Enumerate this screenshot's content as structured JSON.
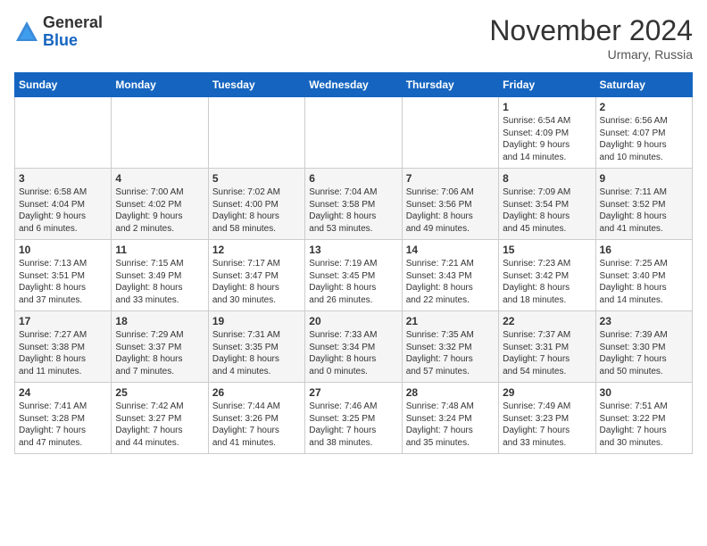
{
  "logo": {
    "general": "General",
    "blue": "Blue"
  },
  "header": {
    "month": "November 2024",
    "location": "Urmary, Russia"
  },
  "weekdays": [
    "Sunday",
    "Monday",
    "Tuesday",
    "Wednesday",
    "Thursday",
    "Friday",
    "Saturday"
  ],
  "weeks": [
    [
      {
        "day": "",
        "info": ""
      },
      {
        "day": "",
        "info": ""
      },
      {
        "day": "",
        "info": ""
      },
      {
        "day": "",
        "info": ""
      },
      {
        "day": "",
        "info": ""
      },
      {
        "day": "1",
        "info": "Sunrise: 6:54 AM\nSunset: 4:09 PM\nDaylight: 9 hours\nand 14 minutes."
      },
      {
        "day": "2",
        "info": "Sunrise: 6:56 AM\nSunset: 4:07 PM\nDaylight: 9 hours\nand 10 minutes."
      }
    ],
    [
      {
        "day": "3",
        "info": "Sunrise: 6:58 AM\nSunset: 4:04 PM\nDaylight: 9 hours\nand 6 minutes."
      },
      {
        "day": "4",
        "info": "Sunrise: 7:00 AM\nSunset: 4:02 PM\nDaylight: 9 hours\nand 2 minutes."
      },
      {
        "day": "5",
        "info": "Sunrise: 7:02 AM\nSunset: 4:00 PM\nDaylight: 8 hours\nand 58 minutes."
      },
      {
        "day": "6",
        "info": "Sunrise: 7:04 AM\nSunset: 3:58 PM\nDaylight: 8 hours\nand 53 minutes."
      },
      {
        "day": "7",
        "info": "Sunrise: 7:06 AM\nSunset: 3:56 PM\nDaylight: 8 hours\nand 49 minutes."
      },
      {
        "day": "8",
        "info": "Sunrise: 7:09 AM\nSunset: 3:54 PM\nDaylight: 8 hours\nand 45 minutes."
      },
      {
        "day": "9",
        "info": "Sunrise: 7:11 AM\nSunset: 3:52 PM\nDaylight: 8 hours\nand 41 minutes."
      }
    ],
    [
      {
        "day": "10",
        "info": "Sunrise: 7:13 AM\nSunset: 3:51 PM\nDaylight: 8 hours\nand 37 minutes."
      },
      {
        "day": "11",
        "info": "Sunrise: 7:15 AM\nSunset: 3:49 PM\nDaylight: 8 hours\nand 33 minutes."
      },
      {
        "day": "12",
        "info": "Sunrise: 7:17 AM\nSunset: 3:47 PM\nDaylight: 8 hours\nand 30 minutes."
      },
      {
        "day": "13",
        "info": "Sunrise: 7:19 AM\nSunset: 3:45 PM\nDaylight: 8 hours\nand 26 minutes."
      },
      {
        "day": "14",
        "info": "Sunrise: 7:21 AM\nSunset: 3:43 PM\nDaylight: 8 hours\nand 22 minutes."
      },
      {
        "day": "15",
        "info": "Sunrise: 7:23 AM\nSunset: 3:42 PM\nDaylight: 8 hours\nand 18 minutes."
      },
      {
        "day": "16",
        "info": "Sunrise: 7:25 AM\nSunset: 3:40 PM\nDaylight: 8 hours\nand 14 minutes."
      }
    ],
    [
      {
        "day": "17",
        "info": "Sunrise: 7:27 AM\nSunset: 3:38 PM\nDaylight: 8 hours\nand 11 minutes."
      },
      {
        "day": "18",
        "info": "Sunrise: 7:29 AM\nSunset: 3:37 PM\nDaylight: 8 hours\nand 7 minutes."
      },
      {
        "day": "19",
        "info": "Sunrise: 7:31 AM\nSunset: 3:35 PM\nDaylight: 8 hours\nand 4 minutes."
      },
      {
        "day": "20",
        "info": "Sunrise: 7:33 AM\nSunset: 3:34 PM\nDaylight: 8 hours\nand 0 minutes."
      },
      {
        "day": "21",
        "info": "Sunrise: 7:35 AM\nSunset: 3:32 PM\nDaylight: 7 hours\nand 57 minutes."
      },
      {
        "day": "22",
        "info": "Sunrise: 7:37 AM\nSunset: 3:31 PM\nDaylight: 7 hours\nand 54 minutes."
      },
      {
        "day": "23",
        "info": "Sunrise: 7:39 AM\nSunset: 3:30 PM\nDaylight: 7 hours\nand 50 minutes."
      }
    ],
    [
      {
        "day": "24",
        "info": "Sunrise: 7:41 AM\nSunset: 3:28 PM\nDaylight: 7 hours\nand 47 minutes."
      },
      {
        "day": "25",
        "info": "Sunrise: 7:42 AM\nSunset: 3:27 PM\nDaylight: 7 hours\nand 44 minutes."
      },
      {
        "day": "26",
        "info": "Sunrise: 7:44 AM\nSunset: 3:26 PM\nDaylight: 7 hours\nand 41 minutes."
      },
      {
        "day": "27",
        "info": "Sunrise: 7:46 AM\nSunset: 3:25 PM\nDaylight: 7 hours\nand 38 minutes."
      },
      {
        "day": "28",
        "info": "Sunrise: 7:48 AM\nSunset: 3:24 PM\nDaylight: 7 hours\nand 35 minutes."
      },
      {
        "day": "29",
        "info": "Sunrise: 7:49 AM\nSunset: 3:23 PM\nDaylight: 7 hours\nand 33 minutes."
      },
      {
        "day": "30",
        "info": "Sunrise: 7:51 AM\nSunset: 3:22 PM\nDaylight: 7 hours\nand 30 minutes."
      }
    ]
  ]
}
